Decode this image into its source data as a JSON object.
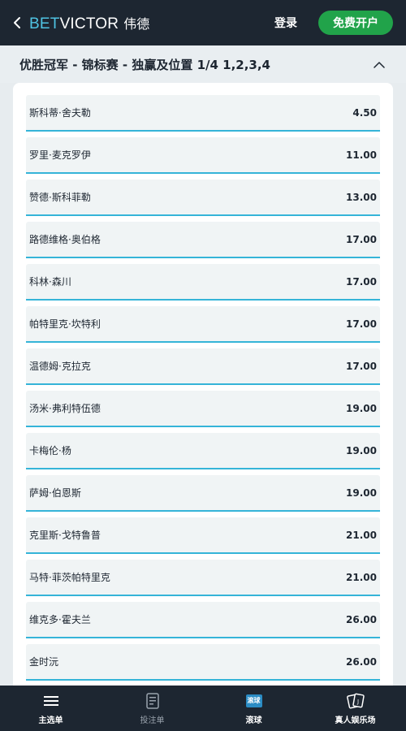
{
  "header": {
    "logo_bet": "BET",
    "logo_victor": "VICTOR",
    "logo_cn": "伟德",
    "login_label": "登录",
    "register_label": "免费开户"
  },
  "market": {
    "title": "优胜冠军 - 锦标赛 - 独赢及位置 1/4 1,2,3,4"
  },
  "selections": [
    {
      "name": "斯科蒂·舍夫勒",
      "odds": "4.50"
    },
    {
      "name": "罗里·麦克罗伊",
      "odds": "11.00"
    },
    {
      "name": "赞德·斯科菲勒",
      "odds": "13.00"
    },
    {
      "name": "路德维格·奥伯格",
      "odds": "17.00"
    },
    {
      "name": "科林·森川",
      "odds": "17.00"
    },
    {
      "name": "帕特里克·坎特利",
      "odds": "17.00"
    },
    {
      "name": "温德姆·克拉克",
      "odds": "17.00"
    },
    {
      "name": "汤米·弗利特伍德",
      "odds": "19.00"
    },
    {
      "name": "卡梅伦·杨",
      "odds": "19.00"
    },
    {
      "name": "萨姆·伯恩斯",
      "odds": "19.00"
    },
    {
      "name": "克里斯·戈特鲁普",
      "odds": "21.00"
    },
    {
      "name": "马特·菲茨帕特里克",
      "odds": "21.00"
    },
    {
      "name": "维克多·霍夫兰",
      "odds": "26.00"
    },
    {
      "name": "金时沅",
      "odds": "26.00"
    }
  ],
  "bottom_nav": {
    "items": [
      {
        "label": "主选单",
        "icon": "menu-icon"
      },
      {
        "label": "投注单",
        "icon": "betslip-icon"
      },
      {
        "label": "滚球",
        "icon": "live-icon",
        "badge": "滚球"
      },
      {
        "label": "真人娱乐场",
        "icon": "cards-icon"
      }
    ]
  },
  "colors": {
    "header_bg": "#1d2631",
    "brand_blue": "#4fc3e3",
    "register_green": "#21a34a",
    "row_underline": "#35b4d8",
    "live_blue": "#2b8cc4"
  }
}
